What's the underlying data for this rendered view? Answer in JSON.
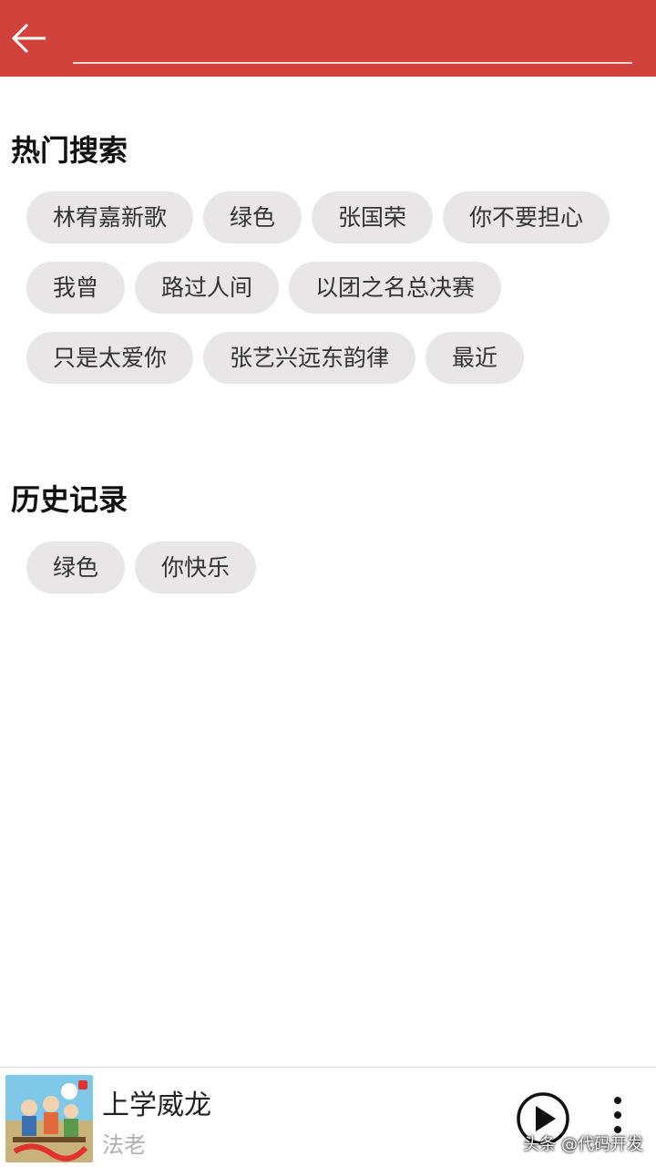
{
  "header": {
    "search_value": "",
    "search_placeholder": "",
    "accent_color": "#d0423b",
    "back_icon": "arrow-left-icon"
  },
  "hot_search": {
    "title": "热门搜索",
    "rows": [
      [
        "林宥嘉新歌",
        "绿色",
        "张国荣",
        "你不要担心"
      ],
      [
        "我曾",
        "路过人间",
        "以团之名总决赛"
      ],
      [
        "只是太爱你",
        "张艺兴远东韵律",
        "最近"
      ]
    ]
  },
  "history": {
    "title": "历史记录",
    "rows": [
      [
        "绿色",
        "你快乐"
      ]
    ]
  },
  "player": {
    "song_title": "上学威龙",
    "artist": "法老",
    "play_icon": "play-icon",
    "more_icon": "more-vertical-icon",
    "album_art": "album-art-thumbnail"
  },
  "watermark": "头条 @代码开发"
}
